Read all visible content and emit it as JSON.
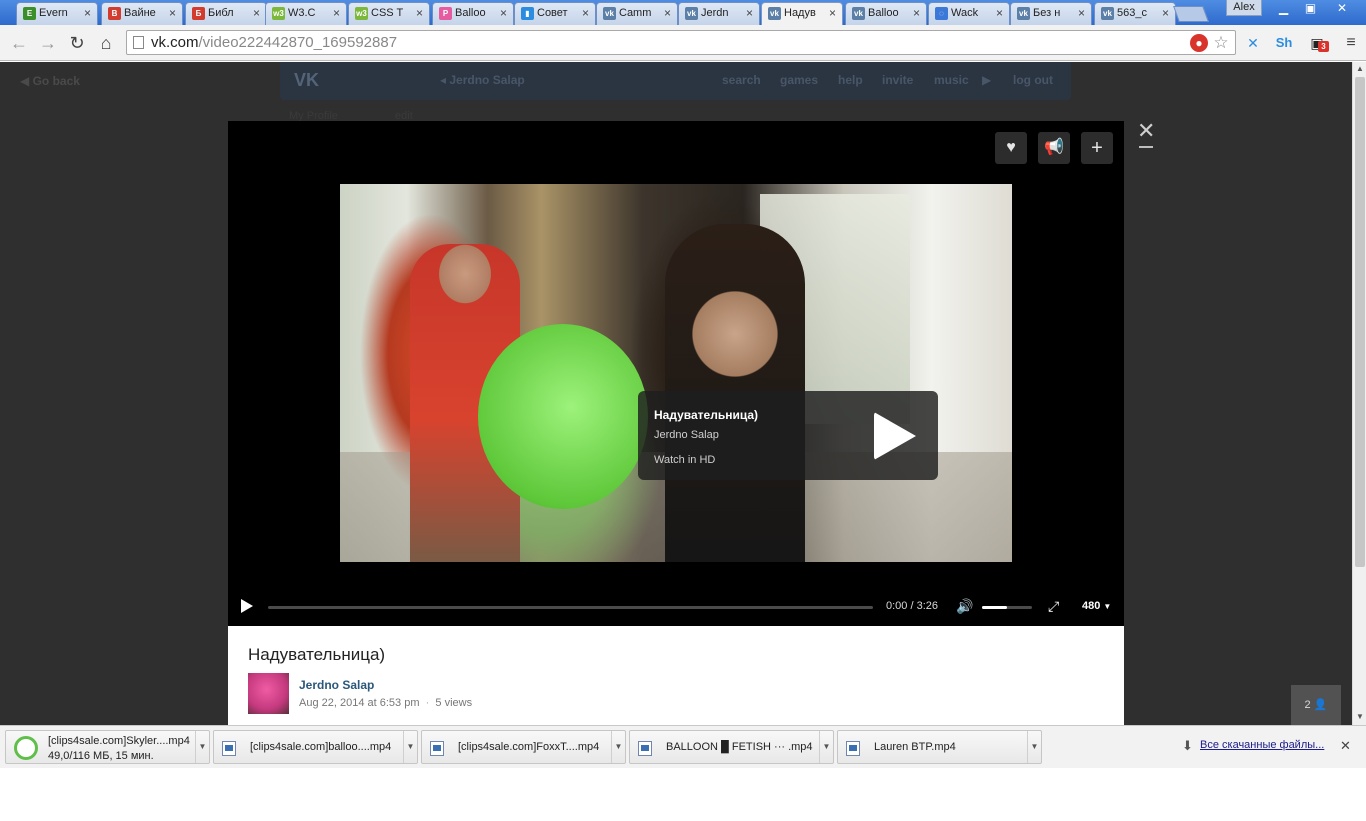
{
  "browser": {
    "user_name": "Alex",
    "tabs": [
      {
        "label": "Evern",
        "icon": "evernote-icon",
        "color": "#3b8f2a",
        "glyph": "E"
      },
      {
        "label": "Вайне",
        "icon": "colorful-app-icon",
        "color": "#d13c2f",
        "glyph": "В"
      },
      {
        "label": "Библ",
        "icon": "colorful-app-icon",
        "color": "#d13c2f",
        "glyph": "Б"
      },
      {
        "label": "W3.C",
        "icon": "w3-icon",
        "color": "#7bb83b",
        "glyph": "w3"
      },
      {
        "label": "CSS T",
        "icon": "w3-icon",
        "color": "#7bb83b",
        "glyph": "w3"
      },
      {
        "label": "Balloo",
        "icon": "p-icon",
        "color": "#e65ca0",
        "glyph": "P"
      },
      {
        "label": "Совет",
        "icon": "book-icon",
        "color": "#2a8de0",
        "glyph": "▮"
      },
      {
        "label": "Camm",
        "icon": "vk-icon",
        "color": "#5b7fa6",
        "glyph": "vk"
      },
      {
        "label": "Jerdn",
        "icon": "vk-icon",
        "color": "#5b7fa6",
        "glyph": "vk"
      },
      {
        "label": "Надув",
        "icon": "vk-icon",
        "color": "#5b7fa6",
        "glyph": "vk",
        "active": true
      },
      {
        "label": "Balloo",
        "icon": "vk-icon",
        "color": "#5b7fa6",
        "glyph": "vk"
      },
      {
        "label": "Wack",
        "icon": "loading-icon",
        "color": "#3b78d8",
        "glyph": "◌"
      },
      {
        "label": "Без н",
        "icon": "vk-icon",
        "color": "#5b7fa6",
        "glyph": "vk"
      },
      {
        "label": "563_c",
        "icon": "vk-icon",
        "color": "#5b7fa6",
        "glyph": "vk"
      }
    ],
    "url_host": "vk.com",
    "url_path": "/video222442870_169592887",
    "extension_badge": "3"
  },
  "vk": {
    "go_back": "Go back",
    "profile_name": "Jerdno Salap",
    "nav": [
      "search",
      "games",
      "help",
      "invite",
      "music"
    ],
    "logout": "log out",
    "sidebar_my_profile": "My Profile",
    "sidebar_edit": "edit"
  },
  "video": {
    "title": "Надувательница)",
    "author": "Jerdno Salap",
    "watch_hd": "Watch in HD",
    "time": "0:00 / 3:26",
    "volume_level": 0.5,
    "quality": "480",
    "date": "Aug 22, 2014 at 6:53 pm",
    "views": "5 views",
    "counter": "2"
  },
  "downloads": {
    "items": [
      {
        "name": "[clips4sale.com]Skyler....mp4",
        "sub": "49,0/116 МБ, 15 мин.",
        "in_progress": true
      },
      {
        "name": "[clips4sale.com]balloo....mp4"
      },
      {
        "name": "[clips4sale.com]FoxxT....mp4"
      },
      {
        "name": "BALLOON █ FETISH ··· .mp4"
      },
      {
        "name": "Lauren BTP.mp4"
      }
    ],
    "show_all": "Все скачанные файлы..."
  }
}
